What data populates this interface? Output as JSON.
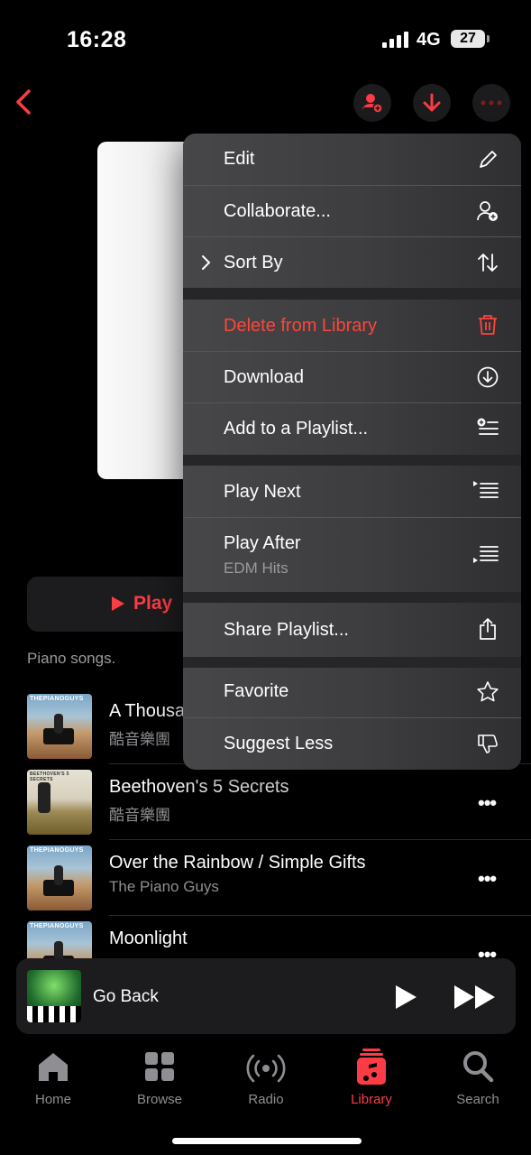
{
  "status_bar": {
    "time": "16:28",
    "network": "4G",
    "battery": "27"
  },
  "accent_color": "#fc3c44",
  "nav": {
    "back_icon": "chevron-left-icon",
    "add_person_icon": "person-add-icon",
    "download_icon": "arrow-down-icon",
    "more_icon": "ellipsis-icon"
  },
  "play_button": {
    "label": "Play"
  },
  "description": "Piano songs.",
  "menu": {
    "items": [
      {
        "label": "Edit",
        "icon": "pencil-icon"
      },
      {
        "label": "Collaborate...",
        "icon": "person-add-icon"
      },
      {
        "label": "Sort By",
        "icon": "sort-arrows-icon"
      },
      {
        "label": "Delete from Library",
        "icon": "trash-icon"
      },
      {
        "label": "Download",
        "icon": "download-circle-icon"
      },
      {
        "label": "Add to a Playlist...",
        "icon": "add-to-playlist-icon"
      },
      {
        "label": "Play Next",
        "icon": "play-next-icon"
      },
      {
        "label": "Play After",
        "sublabel": "EDM Hits",
        "icon": "play-after-icon"
      },
      {
        "label": "Share Playlist...",
        "icon": "share-icon"
      },
      {
        "label": "Favorite",
        "icon": "star-icon"
      },
      {
        "label": "Suggest Less",
        "icon": "thumbs-down-icon"
      }
    ]
  },
  "songs": [
    {
      "title": "A Thousa",
      "artist": "酷音樂團",
      "art_text": "THEPIANOGUYS"
    },
    {
      "title": "Beethoven's 5 Secrets",
      "artist": "酷音樂團",
      "art_text": "BEETHOVEN'S 5 SECRETS"
    },
    {
      "title": "Over the Rainbow / Simple Gifts",
      "artist": "The Piano Guys",
      "art_text": "THEPIANOGUYS"
    },
    {
      "title": "Moonlight",
      "artist": "",
      "art_text": "THEPIANOGUYS"
    }
  ],
  "mini_player": {
    "title": "Go Back"
  },
  "tabs": [
    {
      "label": "Home",
      "icon": "house-icon"
    },
    {
      "label": "Browse",
      "icon": "grid-icon"
    },
    {
      "label": "Radio",
      "icon": "radio-waves-icon"
    },
    {
      "label": "Library",
      "icon": "music-library-icon",
      "active": true
    },
    {
      "label": "Search",
      "icon": "magnifier-icon"
    }
  ]
}
